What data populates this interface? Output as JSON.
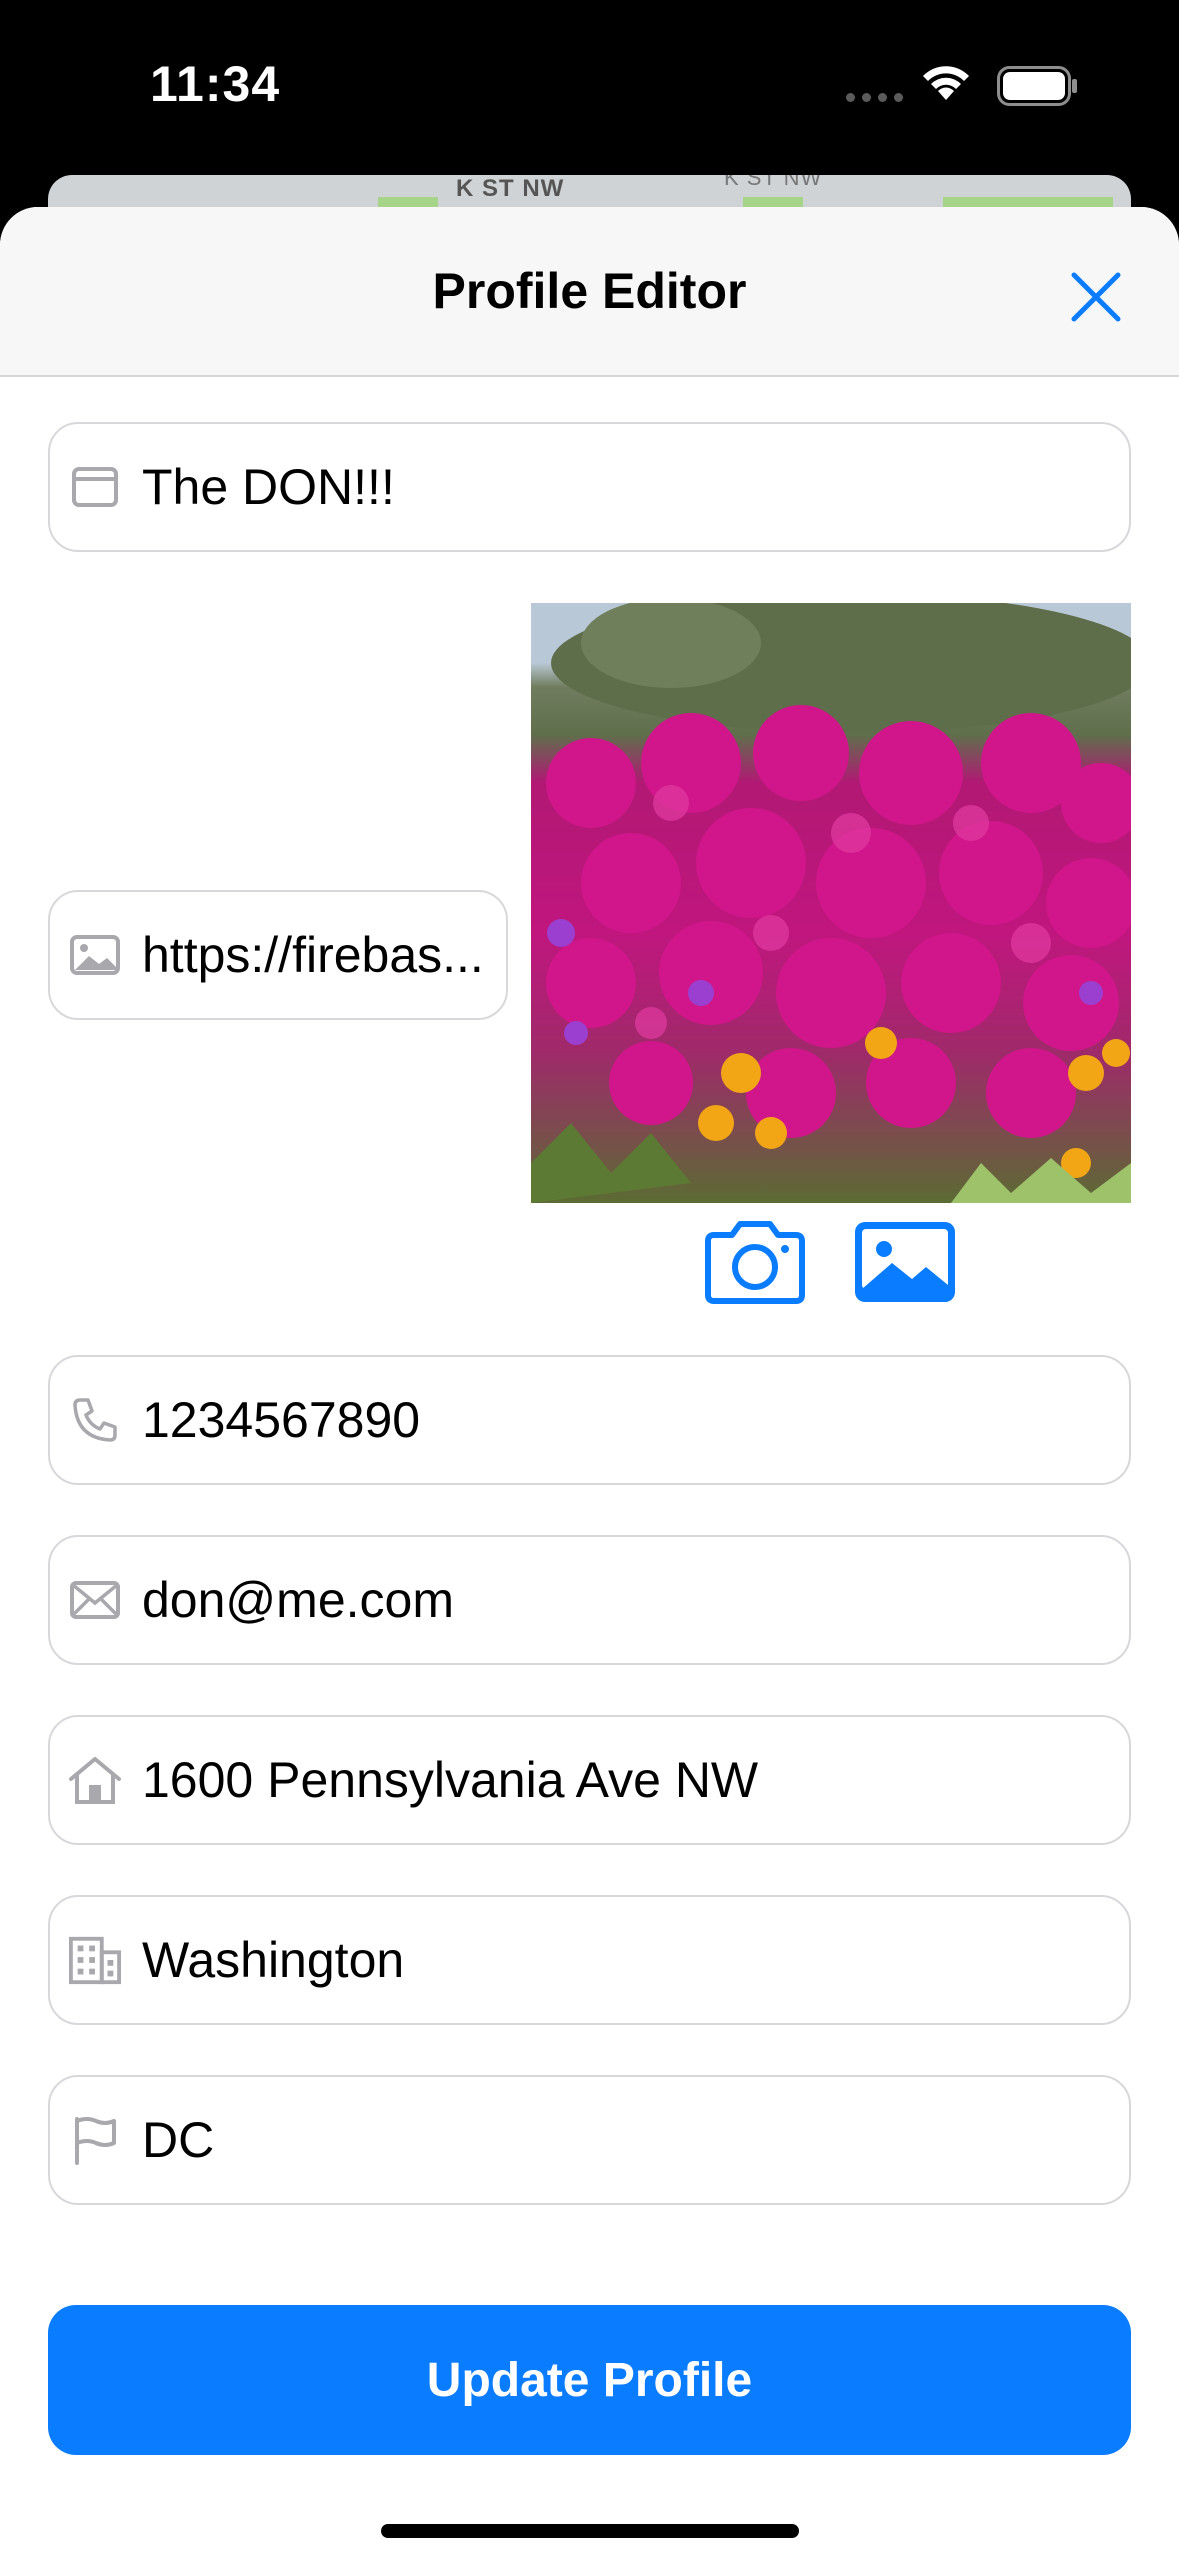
{
  "status_bar": {
    "time": "11:34"
  },
  "map": {
    "street_label": "K ST NW",
    "street_label_2": "K ST NW"
  },
  "header": {
    "title": "Profile Editor"
  },
  "fields": {
    "name": "The DON!!!",
    "image_url": "https://firebas...",
    "phone": "1234567890",
    "email": "don@me.com",
    "street": "1600 Pennsylvania Ave NW",
    "city": "Washington",
    "state": "DC"
  },
  "icons": {
    "name": "window-icon",
    "image_url": "photo-icon",
    "phone": "phone-icon",
    "email": "envelope-icon",
    "street": "house-icon",
    "city": "building-icon",
    "state": "flag-icon",
    "camera": "camera-icon",
    "library": "photo-library-icon",
    "close": "close-icon"
  },
  "actions": {
    "update_label": "Update Profile"
  },
  "colors": {
    "accent": "#0a7cff",
    "field_border": "#d8d8dc",
    "icon_gray": "#a8a8ad"
  }
}
